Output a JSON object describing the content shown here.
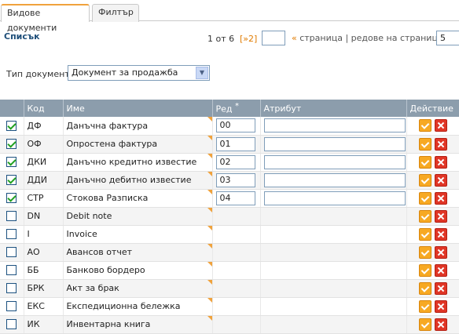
{
  "tabs": [
    {
      "label": "Видове документи",
      "active": true
    },
    {
      "label": "Филтър",
      "active": false
    }
  ],
  "list": {
    "title": "Списък",
    "pager": {
      "count": "1 от 6",
      "next": "[»2]",
      "page_value": "",
      "text_prefix": "«",
      "text_middle": " страница | редове на страница ",
      "text_suffix": "»",
      "rows_value": "5"
    }
  },
  "filter": {
    "label": "Тип документ",
    "selected": "Документ за продажба"
  },
  "table": {
    "headers": {
      "check": "",
      "code": "Код",
      "name": "Име",
      "order": "Ред",
      "order_required": "*",
      "attribute": "Атрибут",
      "action": "Действие"
    },
    "rows": [
      {
        "checked": true,
        "code": "ДФ",
        "name": "Данъчна фактура",
        "order": "00",
        "attr": ""
      },
      {
        "checked": true,
        "code": "ОФ",
        "name": "Опростена фактура",
        "order": "01",
        "attr": ""
      },
      {
        "checked": true,
        "code": "ДКИ",
        "name": "Данъчно кредитно известие",
        "order": "02",
        "attr": ""
      },
      {
        "checked": true,
        "code": "ДДИ",
        "name": "Данъчно дебитно известие",
        "order": "03",
        "attr": ""
      },
      {
        "checked": true,
        "code": "СТР",
        "name": "Стокова Разписка",
        "order": "04",
        "attr": ""
      },
      {
        "checked": false,
        "code": "DN",
        "name": "Debit note",
        "order": null,
        "attr": null
      },
      {
        "checked": false,
        "code": "I",
        "name": "Invoice",
        "order": null,
        "attr": null
      },
      {
        "checked": false,
        "code": "АО",
        "name": "Авансов отчет",
        "order": null,
        "attr": null
      },
      {
        "checked": false,
        "code": "ББ",
        "name": "Банково бордеро",
        "order": null,
        "attr": null
      },
      {
        "checked": false,
        "code": "БРК",
        "name": "Акт за брак",
        "order": null,
        "attr": null
      },
      {
        "checked": false,
        "code": "ЕКС",
        "name": "Експедиционна бележка",
        "order": null,
        "attr": null
      },
      {
        "checked": false,
        "code": "ИК",
        "name": "Инвентарна книга",
        "order": null,
        "attr": null
      }
    ]
  },
  "colors": {
    "header_bg": "#8c9dac",
    "accent_orange": "#f0a23c",
    "title_blue": "#1e4e79"
  }
}
